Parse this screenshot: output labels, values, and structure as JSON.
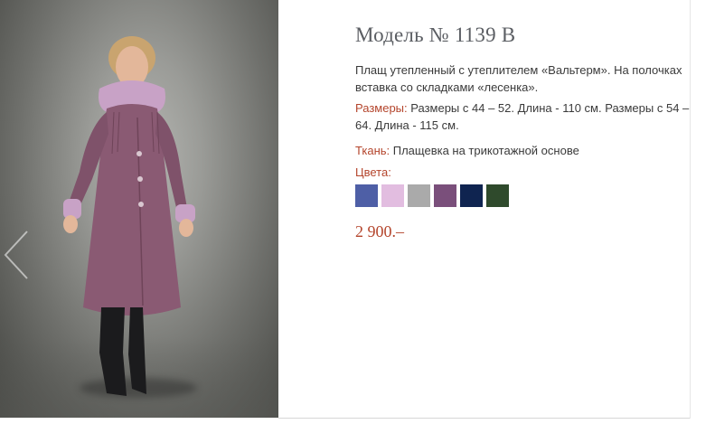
{
  "product": {
    "title": "Модель № 1139 В",
    "description": "Плащ утепленный с утеплителем «Вальтерм». На полочках вставка со складками «лесенка».",
    "sizes_label": "Размеры:",
    "sizes_value": " Размеры с 44 – 52. Длина - 110 см. Размеры с 54 – 64. Длина - 115 см.",
    "fabric_label": "Ткань:",
    "fabric_value": " Плащевка на трикотажной основе",
    "colors_label": "Цвета:",
    "colors": [
      "#4e5fa6",
      "#e2bde0",
      "#aaaaaa",
      "#7a4f7b",
      "#0f2450",
      "#2f4a2c"
    ],
    "price": "2 900.–"
  },
  "gallery": {
    "prev_icon": "chevron-left-icon",
    "photo_subject": "coat-photo",
    "coat_color": "#8a5a73"
  },
  "theme": {
    "accent": "#b4452c",
    "title_color": "#5b5e63"
  }
}
